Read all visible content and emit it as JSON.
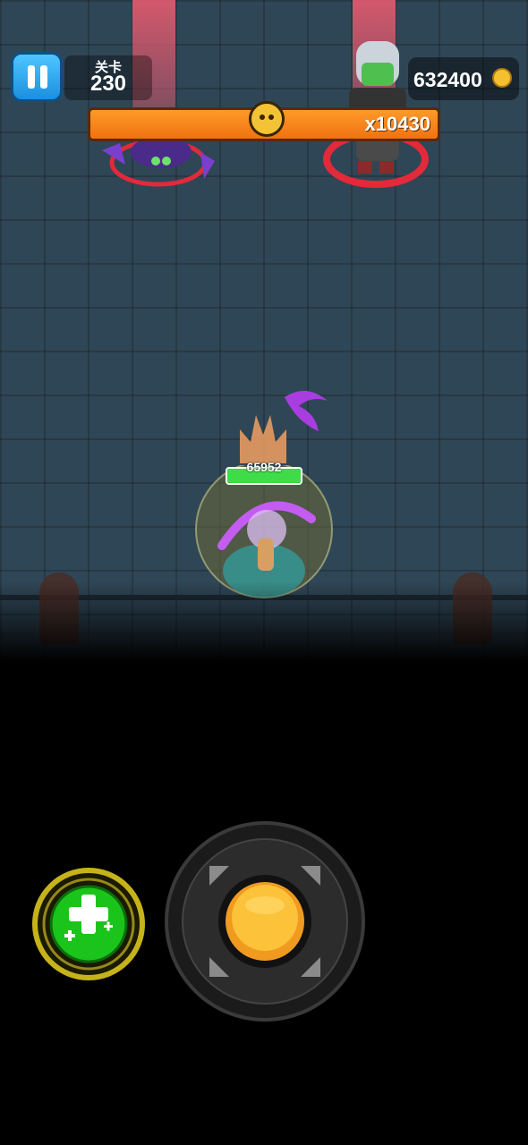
{
  "hud": {
    "level_label": "关卡",
    "level_number": "230",
    "coins": "632400",
    "pause_icon": "pause-icon",
    "coin_icon": "gold-coin-icon"
  },
  "boss": {
    "multiplier": "x10430",
    "icon": "bull-boss-icon",
    "bar_color": "#f7841a"
  },
  "player": {
    "hp": "65952",
    "hp_fraction": 1.0
  },
  "controls": {
    "skill_icon": "heal-plus-icon",
    "joystick_icon": "joystick-knob"
  },
  "colors": {
    "floor": "#2f4656",
    "accent_green": "#3ddc48",
    "accent_gold": "#f5c030"
  }
}
